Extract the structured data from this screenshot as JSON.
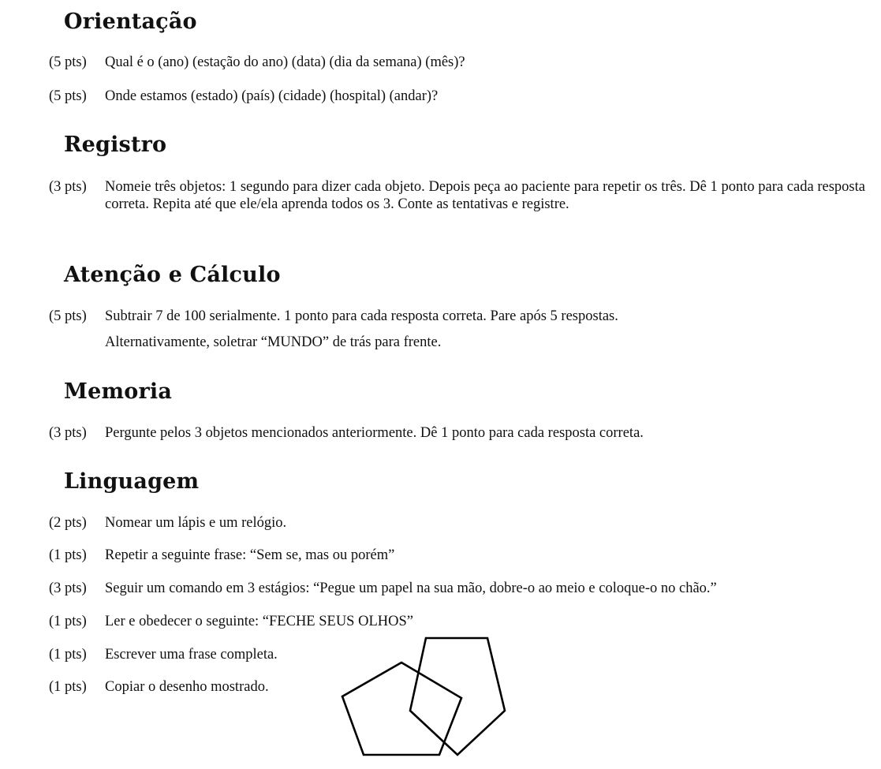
{
  "sections": [
    {
      "title": "Orientação",
      "items": [
        {
          "pts": "(5 pts)",
          "text": "Qual é o (ano) (estação do ano) (data) (dia da semana) (mês)?"
        },
        {
          "pts": "(5 pts)",
          "text": "Onde estamos (estado) (país) (cidade) (hospital) (andar)?"
        }
      ]
    },
    {
      "title": "Registro",
      "items": [
        {
          "pts": "(3 pts)",
          "text": "Nomeie três objetos: 1 segundo para dizer cada objeto. Depois peça ao paciente para repetir os três. Dê 1 ponto para cada resposta correta. Repita até que ele/ela aprenda todos os 3. Conte as tentativas e registre."
        }
      ]
    },
    {
      "title": "Atenção e Cálculo",
      "items": [
        {
          "pts": "(5 pts)",
          "text": "Subtrair 7 de 100 serialmente. 1 ponto para cada resposta correta. Pare após 5 respostas."
        }
      ],
      "continuation": "Alternativamente, soletrar “MUNDO” de trás para frente."
    },
    {
      "title": "Memoria",
      "items": [
        {
          "pts": "(3 pts)",
          "text": "Pergunte pelos 3 objetos mencionados anteriormente. Dê 1 ponto para cada resposta correta."
        }
      ]
    },
    {
      "title": "Linguagem",
      "items": [
        {
          "pts": "(2 pts)",
          "text": "Nomear um lápis e um relógio."
        },
        {
          "pts": "(1 pts)",
          "text": "Repetir a seguinte frase: “Sem se, mas ou porém”"
        },
        {
          "pts": "(3 pts)",
          "text": "Seguir um comando em 3 estágios: “Pegue um papel na sua mão, dobre-o ao meio e coloque-o no chão.”"
        },
        {
          "pts": "(1 pts)",
          "text": "Ler e obedecer o seguinte: “FECHE SEUS OLHOS”"
        },
        {
          "pts": "(1 pts)",
          "text": "Escrever uma frase completa."
        },
        {
          "pts": "(1 pts)",
          "text": "Copiar o desenho mostrado."
        }
      ]
    }
  ],
  "drawing": {
    "description_icon": "intersecting-pentagons-icon",
    "stroke_color": "#000000"
  }
}
